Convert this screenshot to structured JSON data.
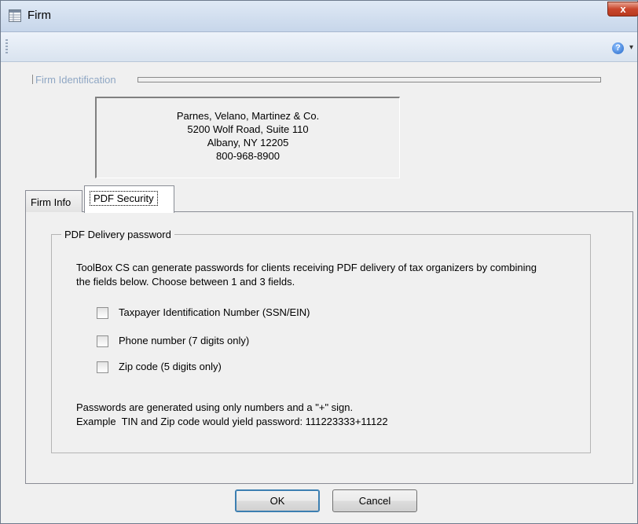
{
  "window": {
    "title": "Firm",
    "title_icon": "table-icon",
    "close_label": "x"
  },
  "toolbar": {
    "help_icon": "help-icon",
    "help_glyph": "?",
    "dropdown_glyph": "▾"
  },
  "firm_identification": {
    "label": "Firm Identification",
    "address_lines": [
      "Parnes, Velano, Martinez & Co.",
      "5200 Wolf Road, Suite 110",
      "Albany, NY 12205",
      "800-968-8900"
    ]
  },
  "tabs": [
    {
      "label": "Firm Info",
      "active": false
    },
    {
      "label": "PDF Security",
      "active": true
    }
  ],
  "pdf_security": {
    "group_label": "PDF Delivery password",
    "description": "ToolBox CS can generate passwords for clients receiving PDF delivery of tax organizers by combining the fields below. Choose between 1 and 3 fields.",
    "options": [
      {
        "label": "Taxpayer Identification Number (SSN/EIN)",
        "checked": false
      },
      {
        "label": "Phone number (7 digits only)",
        "checked": false
      },
      {
        "label": "Zip code (5 digits only)",
        "checked": false
      }
    ],
    "note_line1": "Passwords are generated using only numbers and a \"+\" sign.",
    "note_line2": "Example  TIN and Zip code would yield password: 111223333+11122"
  },
  "buttons": {
    "ok": "OK",
    "cancel": "Cancel"
  },
  "colors": {
    "group_label_disabled": "#8fa7c4",
    "close_button": "#c9462c",
    "default_button_border": "#3c7fb1"
  }
}
